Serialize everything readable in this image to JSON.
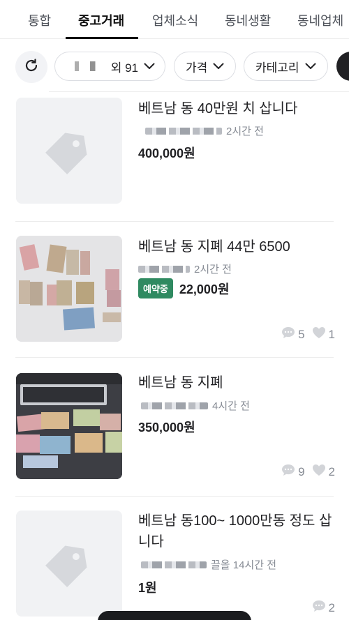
{
  "tabs": [
    {
      "label": "통합"
    },
    {
      "label": "중고거래"
    },
    {
      "label": "업체소식"
    },
    {
      "label": "동네생활"
    },
    {
      "label": "동네업체"
    }
  ],
  "filters": {
    "location_suffix": "외 91",
    "price": "가격",
    "category": "카테고리"
  },
  "items": [
    {
      "title": "베트남 동 40만원 치 삽니다",
      "time": "2시간 전",
      "price": "400,000원",
      "badge": "",
      "chats": "",
      "likes": ""
    },
    {
      "title": "베트남 동 지폐 44만 6500",
      "time": "2시간 전",
      "price": "22,000원",
      "badge": "예약중",
      "chats": "5",
      "likes": "1"
    },
    {
      "title": "베트남 동 지폐",
      "time": "4시간 전",
      "price": "350,000원",
      "badge": "",
      "chats": "9",
      "likes": "2"
    },
    {
      "title": "베트남 동100~ 1000만동 정도 삽니다",
      "time": "끌올 14시간 전",
      "price": "1원",
      "badge": "",
      "chats": "2",
      "likes": ""
    }
  ],
  "colors": {
    "badge_reserved": "#2f8a61",
    "text_primary": "#212124",
    "text_secondary": "#868b94"
  },
  "icons": {
    "refresh": "refresh-icon",
    "chevron": "chevron-down-icon",
    "placeholder": "tag-icon",
    "chat": "chat-bubble-icon",
    "heart": "heart-icon"
  }
}
